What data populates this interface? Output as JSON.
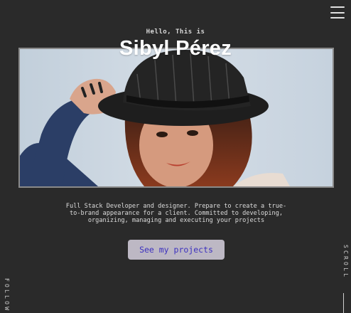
{
  "header": {
    "menu_icon": "hamburger-menu-icon"
  },
  "hero": {
    "intro": "Hello, This is",
    "name": "Sibyl Pérez",
    "bio": "Full Stack Developer and designer. Prepare to create a true-to-brand appearance for a client. Committed to developing, organizing, managing and executing your projects",
    "cta_label": "See my projects"
  },
  "side": {
    "scroll_label": "SCROLL",
    "follow_label": "FOLLOW"
  },
  "colors": {
    "background": "#2a2a2a",
    "button_bg": "#bdb8c4",
    "button_text": "#3b2fbf"
  }
}
